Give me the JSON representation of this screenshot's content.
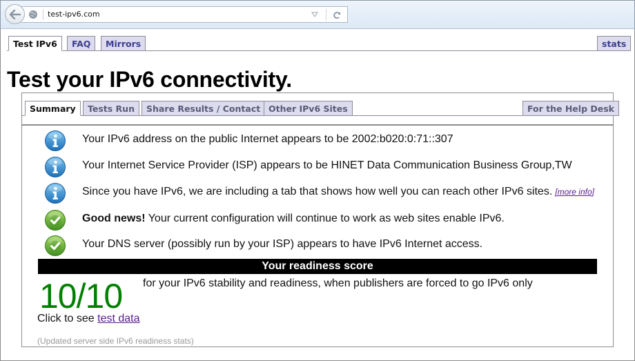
{
  "browser": {
    "url": "test-ipv6.com"
  },
  "top_tabs": [
    {
      "label": "Test IPv6",
      "active": true
    },
    {
      "label": "FAQ",
      "active": false
    },
    {
      "label": "Mirrors",
      "active": false
    }
  ],
  "stats_tab": {
    "label": "stats"
  },
  "page_title": "Test your IPv6 connectivity.",
  "inner_tabs": [
    {
      "label": "Summary",
      "active": true
    },
    {
      "label": "Tests Run",
      "active": false
    },
    {
      "label": "Share Results / Contact",
      "active": false
    },
    {
      "label": "Other IPv6 Sites",
      "active": false
    }
  ],
  "help_desk_tab": {
    "label": "For the Help Desk"
  },
  "messages": [
    {
      "icon": "info-icon",
      "text": "Your IPv6 address on the public Internet appears to be 2002:b020:0:71::307"
    },
    {
      "icon": "info-icon",
      "text": "Your Internet Service Provider (ISP) appears to be HINET Data Communication Business Group,TW"
    },
    {
      "icon": "info-icon",
      "text": "Since you have IPv6, we are including a tab that shows how well you can reach other IPv6 sites.",
      "link": "[more info]"
    },
    {
      "icon": "check-icon",
      "bold": "Good news!",
      "text": " Your current configuration will continue to work as web sites enable IPv6."
    },
    {
      "icon": "check-icon",
      "text": "Your DNS server (possibly run by your ISP) appears to have IPv6 Internet access."
    }
  ],
  "readiness": {
    "header": "Your readiness score",
    "score": "10/10",
    "score_color": "#008000",
    "description": "for your IPv6 stability and readiness, when publishers are forced to go IPv6 only",
    "click_prefix": "Click to see ",
    "click_link": "test data",
    "updated_note": "(Updated server side IPv6 readiness stats)"
  }
}
